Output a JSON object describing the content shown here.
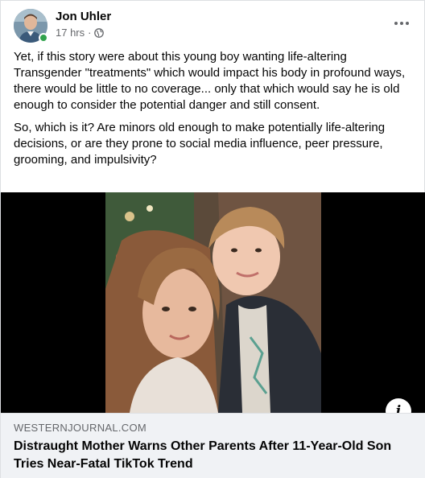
{
  "post": {
    "author": "Jon Uhler",
    "time": "17 hrs",
    "separator": "·",
    "paragraphs": [
      "Yet, if this story were about this young boy wanting life-altering Transgender \"treatments\" which would impact his body in profound ways, there would be little to no coverage... only that which would say he is old enough to consider the potential danger and still consent.",
      "So, which is it? Are minors old enough to make potentially life-altering decisions, or are they prone to social media influence, peer pressure, grooming, and impulsivity?"
    ]
  },
  "link": {
    "domain": "WESTERNJOURNAL.COM",
    "headline": "Distraught Mother Warns Other Parents After 11-Year-Old Son Tries Near-Fatal TikTok Trend"
  },
  "icons": {
    "more": "more-options-icon",
    "privacy": "globe-icon",
    "info": "info-icon"
  },
  "colors": {
    "online": "#31a24c",
    "secondary_text": "#65676b",
    "link_card_bg": "#f0f2f5"
  }
}
